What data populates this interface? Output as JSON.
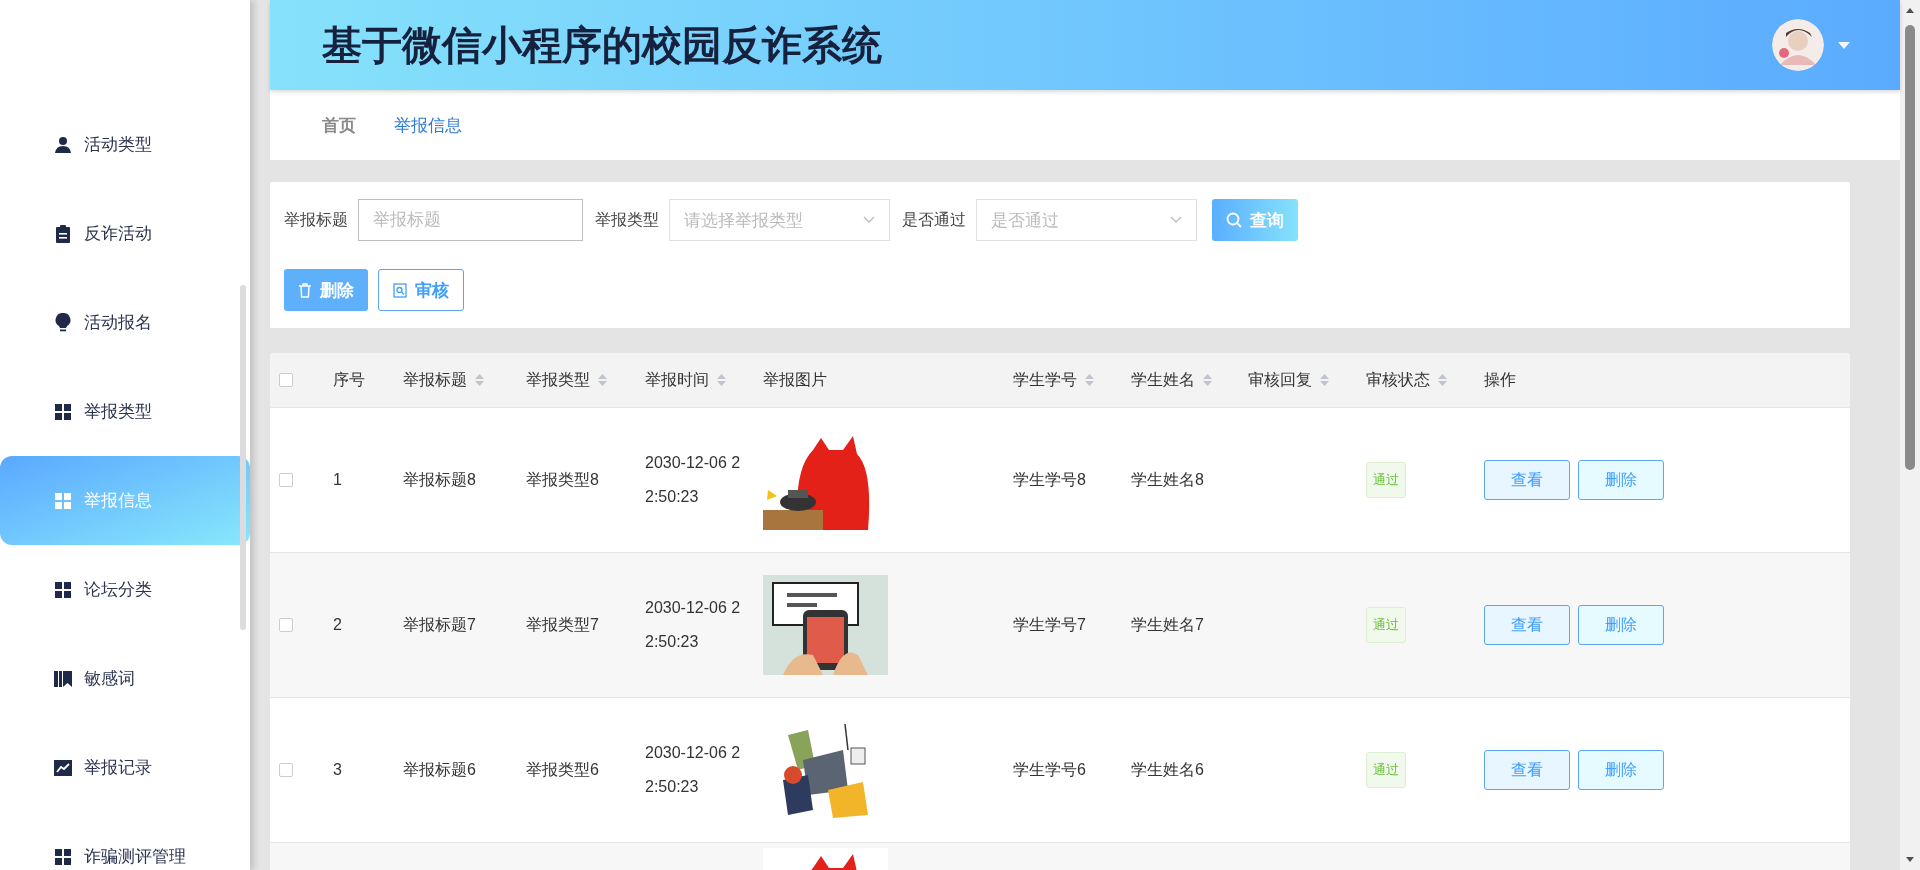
{
  "sidebar": {
    "items": [
      {
        "label": "活动类型",
        "selected": false
      },
      {
        "label": "反诈活动",
        "selected": false
      },
      {
        "label": "活动报名",
        "selected": false
      },
      {
        "label": "举报类型",
        "selected": false
      },
      {
        "label": "举报信息",
        "selected": true
      },
      {
        "label": "论坛分类",
        "selected": false
      },
      {
        "label": "敏感词",
        "selected": false
      },
      {
        "label": "举报记录",
        "selected": false
      },
      {
        "label": "诈骗测评管理",
        "selected": false
      }
    ]
  },
  "header": {
    "title": "基于微信小程序的校园反诈系统"
  },
  "breadcrumb": [
    {
      "label": "首页",
      "selected": false
    },
    {
      "label": "举报信息",
      "selected": true
    }
  ],
  "filters": [
    {
      "label": "举报标题",
      "kind": "text",
      "placeholder": "举报标题"
    },
    {
      "label": "举报类型",
      "kind": "select",
      "placeholder": "请选择举报类型"
    },
    {
      "label": "是否通过",
      "kind": "select",
      "placeholder": "是否通过"
    }
  ],
  "search_button": "查询",
  "actions": [
    {
      "label": "删除",
      "kind": "primary"
    },
    {
      "label": "审核",
      "kind": "outline"
    }
  ],
  "table": {
    "header_checked": false,
    "columns": [
      {
        "label": "序号",
        "sortable": false
      },
      {
        "label": "举报标题",
        "sortable": true
      },
      {
        "label": "举报类型",
        "sortable": true
      },
      {
        "label": "举报时间",
        "sortable": true
      },
      {
        "label": "举报图片",
        "sortable": false
      },
      {
        "label": "学生学号",
        "sortable": true
      },
      {
        "label": "学生姓名",
        "sortable": true
      },
      {
        "label": "审核回复",
        "sortable": true
      },
      {
        "label": "审核状态",
        "sortable": true
      },
      {
        "label": "操作",
        "sortable": false
      }
    ],
    "rows": [
      {
        "checked": false,
        "index": "1",
        "title": "举报标题8",
        "type": "举报类型8",
        "time": "2030-12-06 22:50:23",
        "image": {
          "kind": "picture"
        },
        "student_id": "学生学号8",
        "student_name": "学生姓名8",
        "status": "通过",
        "buttons": [
          "查看",
          "删除"
        ]
      },
      {
        "checked": false,
        "index": "2",
        "title": "举报标题7",
        "type": "举报类型7",
        "time": "2030-12-06 22:50:23",
        "image": {
          "kind": "picture"
        },
        "student_id": "学生学号7",
        "student_name": "学生姓名7",
        "status": "通过",
        "buttons": [
          "查看",
          "删除"
        ]
      },
      {
        "checked": false,
        "index": "3",
        "title": "举报标题6",
        "type": "举报类型6",
        "time": "2030-12-06 22:50:23",
        "image": {
          "kind": "picture"
        },
        "student_id": "学生学号6",
        "student_name": "学生姓名6",
        "status": "通过",
        "buttons": [
          "查看",
          "删除"
        ]
      }
    ],
    "partial_row": {
      "image": {
        "kind": "picture"
      }
    }
  }
}
